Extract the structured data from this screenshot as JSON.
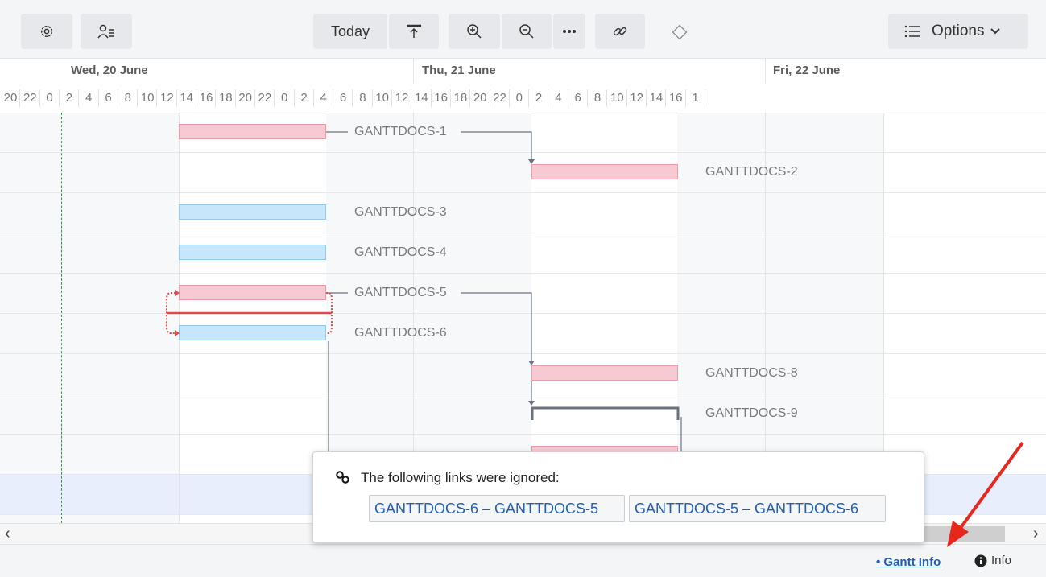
{
  "toolbar": {
    "today_label": "Today",
    "options_label": "Options",
    "icons": [
      "gear-icon",
      "user-list-icon",
      "scroll-to-top-icon",
      "zoom-in-icon",
      "zoom-out-icon",
      "more-icon",
      "link-icon",
      "milestone-diamond-icon",
      "list-icon",
      "chevron-down-icon"
    ]
  },
  "timeline": {
    "dates": [
      "Wed, 20 June",
      "Thu, 21 June",
      "Fri, 22 June"
    ],
    "hours": [
      "20",
      "22",
      "0",
      "2",
      "4",
      "6",
      "8",
      "10",
      "12",
      "14",
      "16",
      "18",
      "20",
      "22",
      "0",
      "2",
      "4",
      "6",
      "8",
      "10",
      "12",
      "14",
      "16",
      "18",
      "20",
      "22",
      "0",
      "2",
      "4",
      "6",
      "8",
      "10",
      "12",
      "14",
      "16",
      "1"
    ]
  },
  "tasks": [
    {
      "label": "GANTTDOCS-1",
      "color": "pink"
    },
    {
      "label": "GANTTDOCS-2",
      "color": "pink"
    },
    {
      "label": "GANTTDOCS-3",
      "color": "blue"
    },
    {
      "label": "GANTTDOCS-4",
      "color": "blue"
    },
    {
      "label": "GANTTDOCS-5",
      "color": "pink"
    },
    {
      "label": "GANTTDOCS-6",
      "color": "blue"
    },
    {
      "label": "GANTTDOCS-8",
      "color": "pink"
    },
    {
      "label": "GANTTDOCS-9",
      "color": "summary"
    }
  ],
  "popup": {
    "message": "The following links were ignored:",
    "links": [
      "GANTTDOCS-6 – GANTTDOCS-5",
      "GANTTDOCS-5 – GANTTDOCS-6"
    ]
  },
  "scroll": {
    "left": "‹",
    "right": "›"
  },
  "footer": {
    "gantt_info": "• Gantt Info",
    "info": "Info"
  },
  "colors": {
    "accent": "#1f5fb5",
    "pink": "#f7c9d2",
    "blue": "#c7e5fb",
    "conflict": "#e24a4a",
    "today_line": "#2e9c3c",
    "arrow": "#e8271c"
  }
}
